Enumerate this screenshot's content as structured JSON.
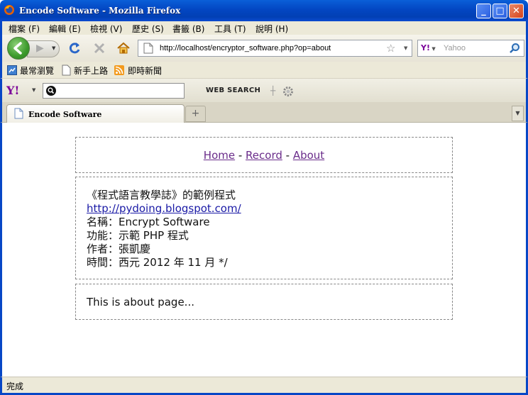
{
  "window": {
    "title": "Encode Software - Mozilla Firefox",
    "controls": {
      "minimize": "_",
      "maximize": "□",
      "close": "✕"
    }
  },
  "menubar": {
    "items": [
      {
        "label": "檔案 (F)"
      },
      {
        "label": "編輯 (E)"
      },
      {
        "label": "檢視 (V)"
      },
      {
        "label": "歷史 (S)"
      },
      {
        "label": "書籤 (B)"
      },
      {
        "label": "工具 (T)"
      },
      {
        "label": "說明 (H)"
      }
    ]
  },
  "navbar": {
    "url": "http://localhost/encryptor_software.php?op=about",
    "search_placeholder": "Yahoo"
  },
  "bookmarks": {
    "items": [
      {
        "label": "最常瀏覽"
      },
      {
        "label": "新手上路"
      },
      {
        "label": "即時新聞"
      }
    ]
  },
  "yahoo_toolbar": {
    "logo": "Y!",
    "web_search_label": "WEB SEARCH"
  },
  "tabs": {
    "items": [
      {
        "label": "Encode Software"
      }
    ],
    "new_tab_symbol": "+"
  },
  "page": {
    "nav": {
      "home": "Home",
      "record": "Record",
      "about": "About",
      "separator": " - "
    },
    "info": {
      "heading": "《程式語言教學誌》的範例程式",
      "link": "http://pydoing.blogspot.com/",
      "name_line": "名稱：Encrypt Software",
      "function_line": "功能：示範 PHP 程式",
      "author_line": "作者：張凱慶",
      "time_line": "時間：西元 2012 年 11 月 */"
    },
    "about_text": "This is about page..."
  },
  "status": {
    "text": "完成"
  },
  "colors": {
    "titlebar_blue": "#0346c2",
    "link_visited": "#6a2c8a",
    "link": "#1a1aa6",
    "chrome": "#ece9d8"
  }
}
